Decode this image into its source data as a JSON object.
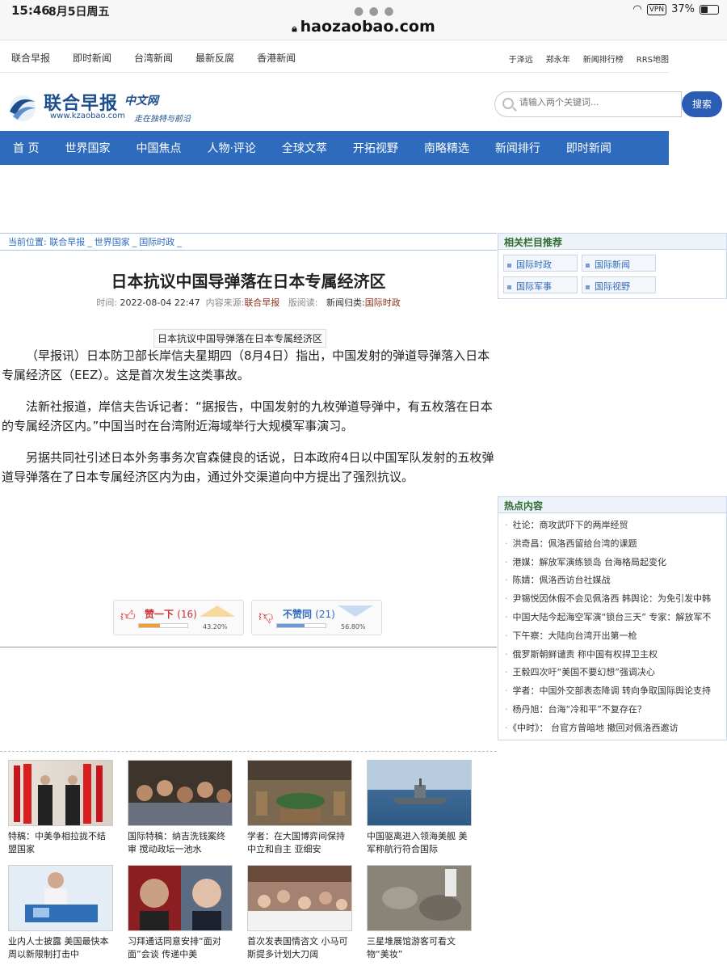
{
  "status": {
    "time": "15:46",
    "date": "8月5日周五",
    "url": "haozaobao.com",
    "battery": "37%",
    "vpn": "VPN"
  },
  "topbar": {
    "left": [
      "联合早报",
      "即时新闻",
      "台湾新闻",
      "最新反腐",
      "香港新闻"
    ],
    "right": [
      "于泽远",
      "郑永年",
      "新闻排行榜",
      "RRS地图"
    ]
  },
  "logo": {
    "brand": "联合早报",
    "brand2": "中文网",
    "url": "www.kzaobao.com",
    "slogan": "走在独特与前沿"
  },
  "search": {
    "placeholder": "请输入两个关键词...",
    "button": "搜索"
  },
  "nav": [
    "首 页",
    "世界国家",
    "中国焦点",
    "人物·评论",
    "全球文萃",
    "开拓视野",
    "南略精选",
    "新闻排行",
    "即时新闻"
  ],
  "breadcrumb": {
    "prefix": "当前位置:",
    "items": [
      "联合早报",
      "世界国家",
      "国际时政"
    ]
  },
  "article": {
    "title": "日本抗议中国导弹落在日本专属经济区",
    "time_label": "时间:",
    "time": "2022-08-04 22:47",
    "source_label": "内容来源:",
    "source": "联合早报",
    "views_label": "版阅读:",
    "category_label": "新闻归类:",
    "category": "国际时政",
    "subhead": "日本抗议中国导弹落在日本专属经济区",
    "paragraphs": [
      "（早报讯）日本防卫部长岸信夫星期四（8月4日）指出，中国发射的弹道导弹落入日本专属经济区（EEZ）。这是首次发生这类事故。",
      "法新社报道，岸信夫告诉记者：“据报告，中国发射的九枚弹道导弹中，有五枚落在日本的专属经济区内。”中国当时在台湾附近海域举行大规模军事演习。",
      "另据共同社引述日本外务事务次官森健良的话说，日本政府4日以中国军队发射的五枚弹道导弹落在了日本专属经济区内为由，通过外交渠道向中方提出了强烈抗议。"
    ]
  },
  "votes": {
    "up": {
      "label": "赞一下",
      "count": "(16)",
      "pct": "43.20%",
      "value": 43.2,
      "color": "#f0a030"
    },
    "down": {
      "label": "不赞同",
      "count": "(21)",
      "pct": "56.80%",
      "value": 56.8,
      "color": "#6a98d8"
    }
  },
  "related": {
    "title": "相关栏目推荐",
    "items": [
      "国际时政",
      "国际新闻",
      "国际军事",
      "国际视野"
    ]
  },
  "hot": {
    "title": "热点内容",
    "items": [
      "社论：商攻武吓下的两岸经贸",
      "洪奇昌：佩洛西留给台湾的课题",
      "港媒：解放军演练锁岛 台海格局起变化",
      "陈婧：佩洛西访台社媒战",
      "尹锡悦因休假不会见佩洛西 韩舆论：为免引发中韩",
      "中国大陆今起海空军演“锁台三天” 专家：解放军不",
      "下午察：大陆向台湾开出第一枪",
      "俄罗斯朝鲜谴责 称中国有权捍卫主权",
      "王毅四次吁“美国不要幻想”强调决心",
      "学者：中国外交部表态降调 转向争取国际舆论支持",
      "杨丹旭：台海“冷和平”不复存在？",
      "《中时》： 台官方曾暗地 撤回对佩洛西邀访"
    ]
  },
  "thumbs": [
    {
      "cap": "特稿：中美争相拉拢不结盟国家"
    },
    {
      "cap": "国际特稿：纳吉洗钱案终审 搅动政坛一池水"
    },
    {
      "cap": "学者：在大国博弈间保持中立和自主 亚细安"
    },
    {
      "cap": "中国驱离进入领海美舰 美军称航行符合国际"
    },
    {
      "cap": "业内人士披露 美国最快本周以新限制打击中"
    },
    {
      "cap": "习拜通话同意安排“面对面”会谈 传递中美"
    },
    {
      "cap": "首次发表国情咨文 小马可斯提多计划大刀阔"
    },
    {
      "cap": "三星堆展馆游客可看文物“美妆”"
    }
  ]
}
